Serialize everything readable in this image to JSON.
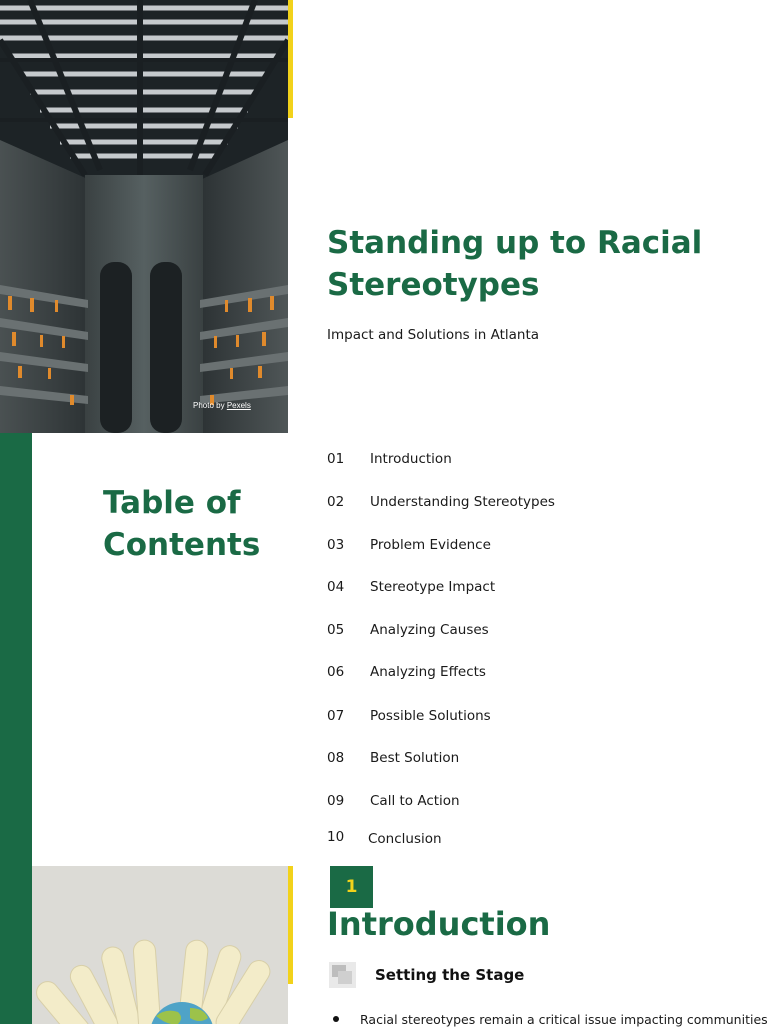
{
  "cover": {
    "title": "Standing up to Racial Stereotypes",
    "subtitle": "Impact and Solutions in Atlanta",
    "photo_credit_prefix": "Photo by ",
    "photo_credit_link": "Pexels",
    "image_subject": "concrete-atrium-skylight-photo"
  },
  "toc": {
    "title": "Table of Contents",
    "items": [
      {
        "num": "01",
        "label": "Introduction"
      },
      {
        "num": "02",
        "label": "Understanding Stereotypes"
      },
      {
        "num": "03",
        "label": "Problem Evidence"
      },
      {
        "num": "04",
        "label": "Stereotype Impact"
      },
      {
        "num": "05",
        "label": "Analyzing Causes"
      },
      {
        "num": "06",
        "label": "Analyzing Effects"
      },
      {
        "num": "07",
        "label": "Possible Solutions"
      },
      {
        "num": "08",
        "label": "Best Solution"
      },
      {
        "num": "09",
        "label": "Call to Action"
      },
      {
        "num": "10",
        "label": "Conclusion"
      }
    ]
  },
  "intro": {
    "number": "1",
    "title": "Introduction",
    "section_heading": "Setting the Stage",
    "section_icon": "image-placeholder-icon",
    "image_subject": "paper-hands-around-globe",
    "bullets": [
      "Racial stereotypes remain a critical issue impacting communities."
    ]
  },
  "colors": {
    "accent_green": "#1a6a45",
    "accent_yellow": "#f2d21b",
    "text": "#1a1a1a"
  }
}
